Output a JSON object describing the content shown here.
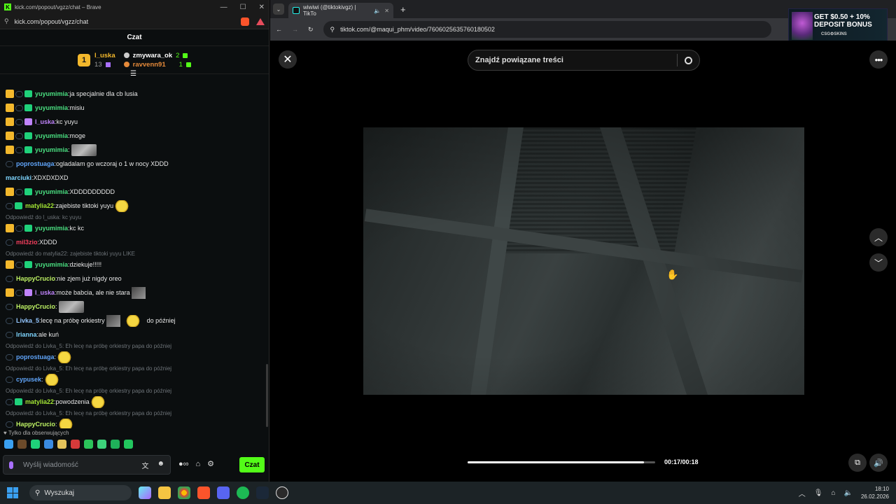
{
  "chat_window": {
    "title": "kick.com/popout/vgzz/chat – Brave",
    "url": "kick.com/popout/vgzz/chat",
    "header": "Czat",
    "leaderboard": {
      "rank": "1",
      "top_user": "l_uska",
      "top_count": "13",
      "second_user": "zmywara_ok",
      "second_count": "2",
      "third_user": "ravvenn91",
      "third_count": "1"
    },
    "messages": [
      {
        "user": "yuyumimia",
        "color": "#4ade80",
        "text": "ja specjalnie dla cb lusia",
        "badges": "crown"
      },
      {
        "user": "yuyumimia",
        "color": "#4ade80",
        "text": "misiu",
        "badges": "crown"
      },
      {
        "user": "l_uska",
        "color": "#c084fc",
        "text": "kc yuyu",
        "badges": "crown-purple"
      },
      {
        "user": "yuyumimia",
        "color": "#4ade80",
        "text": "moge",
        "badges": "crown"
      },
      {
        "user": "yuyumimia",
        "color": "#4ade80",
        "text": "",
        "badges": "crown",
        "emote": "cat"
      },
      {
        "user": "poprostuaga",
        "color": "#60a5fa",
        "text": "ogladalam go wczoraj o 1 w nocy XDDD",
        "badges": "ring"
      },
      {
        "user": "marciuki",
        "color": "#7dd3fc",
        "text": "XDXDXDXD",
        "badges": "none"
      },
      {
        "user": "yuyumimia",
        "color": "#4ade80",
        "text": "XDDDDDDDDD",
        "badges": "crown"
      },
      {
        "user": "matylia22",
        "color": "#a3e635",
        "text": "zajebiste tiktoki yuyu",
        "badges": "ring-green",
        "emote": "yellow"
      },
      {
        "reply": "Odpowiedź do l_uska: kc yuyu"
      },
      {
        "user": "yuyumimia",
        "color": "#4ade80",
        "text": "kc kc",
        "badges": "crown"
      },
      {
        "user": "mil3zio",
        "color": "#f43f5e",
        "text": "XDDD",
        "badges": "ring"
      },
      {
        "reply": "Odpowiedź do matylia22: zajebiste tiktoki yuyu LIKE"
      },
      {
        "user": "yuyumimia",
        "color": "#4ade80",
        "text": "dziekuje!!!!!",
        "badges": "crown"
      },
      {
        "user": "HappyCrucio",
        "color": "#bef264",
        "text": "nie zjem już nigdy oreo",
        "badges": "ring"
      },
      {
        "user": "l_uska",
        "color": "#c084fc",
        "text": "może babcia, ale nie stara",
        "badges": "crown-purple",
        "emote": "small"
      },
      {
        "user": "HappyCrucio",
        "color": "#bef264",
        "text": "",
        "badges": "ring",
        "emote": "cat"
      },
      {
        "user": "Livka_5",
        "color": "#93c5fd",
        "text": "lecę na próbę orkiestry",
        "text2": "do później",
        "badges": "ring",
        "emote": "small",
        "emote2": "yellow"
      },
      {
        "user": "Irianna",
        "color": "#7dd3fc",
        "text": "ale kuń",
        "badges": "ring"
      },
      {
        "reply": "Odpowiedź do Livka_5: Eh lecę na próbę orkiestry papa do później"
      },
      {
        "user": "poprostuaga",
        "color": "#60a5fa",
        "text": "",
        "badges": "ring",
        "emote": "yellow"
      },
      {
        "reply": "Odpowiedź do Livka_5: Eh lecę na próbę orkiestry papa do później"
      },
      {
        "user": "cypusek",
        "color": "#60a5fa",
        "text": "",
        "badges": "ring",
        "emote": "yellow"
      },
      {
        "reply": "Odpowiedź do Livka_5: Eh lecę na próbę orkiestry papa do później"
      },
      {
        "user": "matylia22",
        "color": "#a3e635",
        "text": "powodzenia",
        "badges": "ring-green",
        "emote": "yellow"
      },
      {
        "reply": "Odpowiedź do Livka_5: Eh lecę na próbę orkiestry papa do później"
      },
      {
        "user": "HappyCrucio",
        "color": "#bef264",
        "text": "",
        "badges": "ring",
        "emote": "yellow"
      }
    ],
    "followers_only": "Tylko dla obserwujących",
    "input_placeholder": "Wyślij wiadomość",
    "send_label": "Czat"
  },
  "browser": {
    "tab_title": "wiwiwi (@tiktokivgz) | TikTo",
    "url": "tiktok.com/@maqui_phm/video/7606025635760180502",
    "ad_line1": "GET $0.50 + 10%",
    "ad_line2": "DEPOSIT BONUS",
    "ad_brand": "CSG⚙SKINS",
    "search_placeholder": "Znajdź powiązane treści",
    "time": "00:17/00:18",
    "progress": 0.94
  },
  "taskbar": {
    "search": "Wyszukaj",
    "time": "18:10",
    "date": "26.02.2026"
  },
  "icons": [
    "close-icon",
    "search-icon",
    "more-icon",
    "chevron-up-icon",
    "chevron-down-icon",
    "volume-icon",
    "miniplayer-icon",
    "windows-icon",
    "mic-icon",
    "crown-icon"
  ]
}
